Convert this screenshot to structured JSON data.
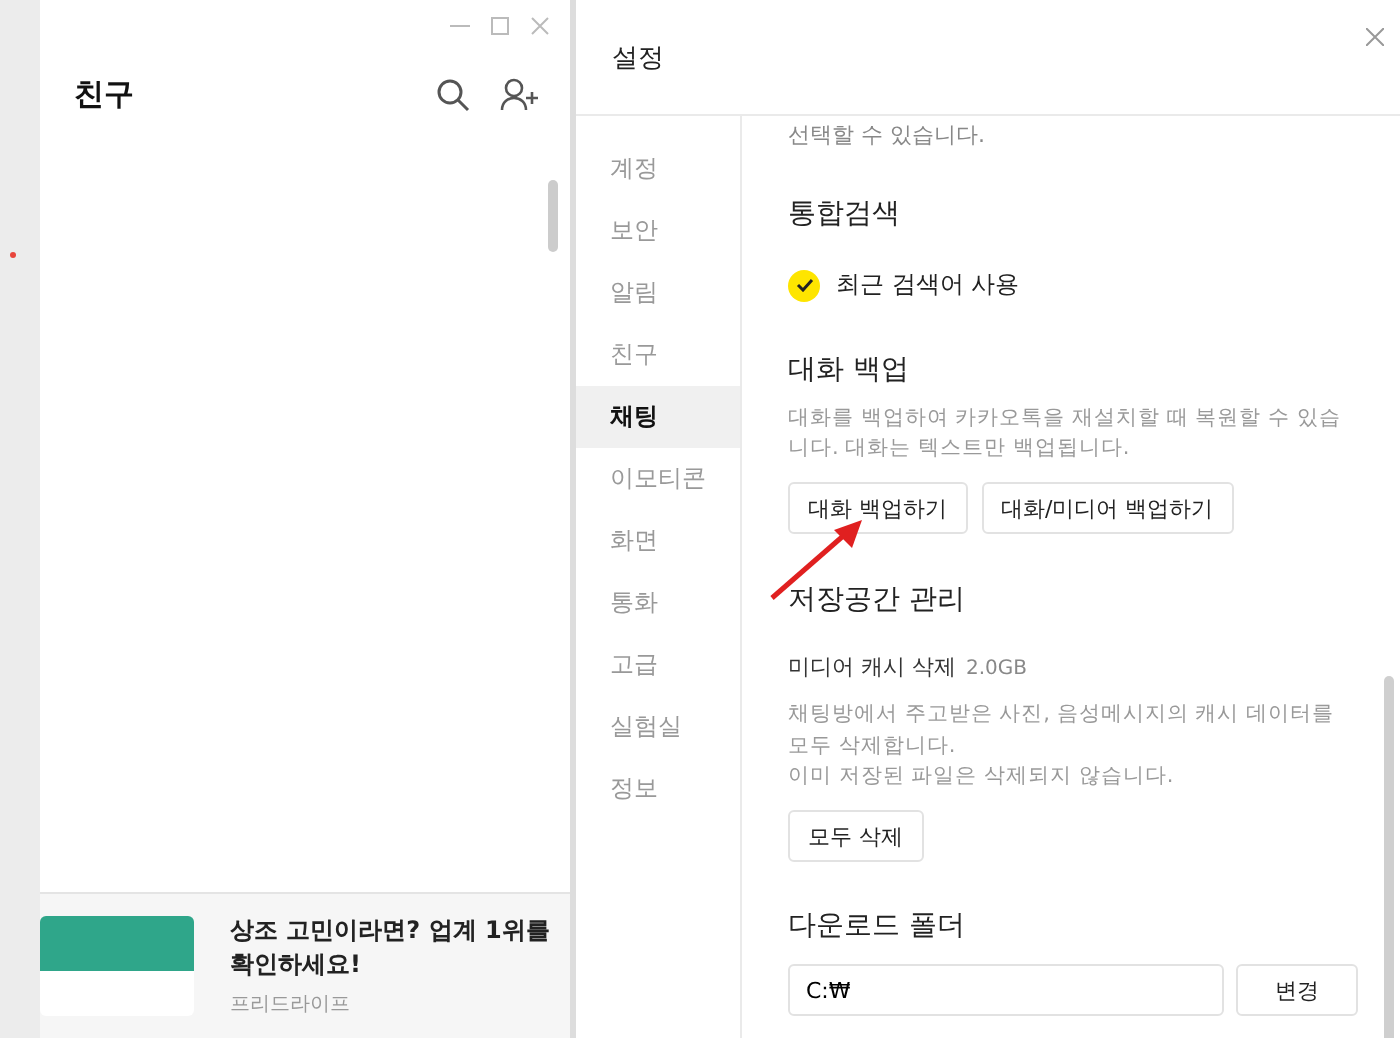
{
  "friends_window": {
    "title": "친구"
  },
  "settings": {
    "title": "설정",
    "nav": [
      {
        "label": "계정",
        "selected": false
      },
      {
        "label": "보안",
        "selected": false
      },
      {
        "label": "알림",
        "selected": false
      },
      {
        "label": "친구",
        "selected": false
      },
      {
        "label": "채팅",
        "selected": true
      },
      {
        "label": "이모티콘",
        "selected": false
      },
      {
        "label": "화면",
        "selected": false
      },
      {
        "label": "통화",
        "selected": false
      },
      {
        "label": "고급",
        "selected": false
      },
      {
        "label": "실험실",
        "selected": false
      },
      {
        "label": "정보",
        "selected": false
      }
    ],
    "cut_text": "선택할 수 있습니다.",
    "search": {
      "heading": "통합검색",
      "option": {
        "label": "최근 검색어 사용",
        "checked": true
      }
    },
    "backup": {
      "heading": "대화 백업",
      "description": "대화를 백업하여 카카오톡을 재설치할 때 복원할 수 있습니다. 대화는 텍스트만 백업됩니다.",
      "buttons": [
        "대화 백업하기",
        "대화/미디어 백업하기"
      ]
    },
    "storage": {
      "heading": "저장공간 관리",
      "item": "미디어 캐시 삭제",
      "size": "2.0GB",
      "description": "채팅방에서 주고받은 사진, 음성메시지의 캐시 데이터를 모두 삭제합니다.",
      "note": "이미 저장된 파일은 삭제되지 않습니다.",
      "button": "모두 삭제"
    },
    "download": {
      "heading": "다운로드 폴더",
      "path": "C:₩",
      "button": "변경"
    }
  },
  "ad": {
    "headline": "상조 고민이라면? 업계 1위를 확인하세요!",
    "advertiser": "프리드라이프"
  }
}
